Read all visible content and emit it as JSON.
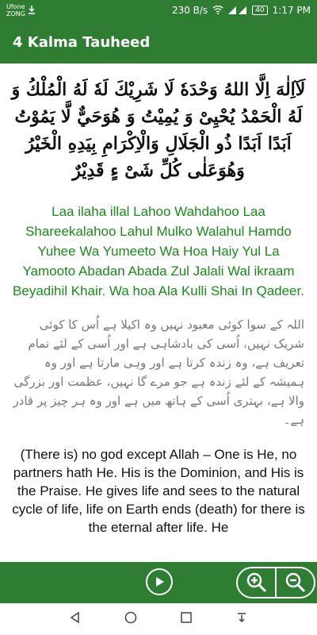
{
  "status_bar": {
    "carrier_top": "Ufone",
    "carrier_bottom": "ZONG",
    "net_speed": "230 B/s",
    "battery": "40",
    "time": "1:17 PM"
  },
  "app_bar": {
    "title": "4 Kalma Tauheed"
  },
  "content": {
    "arabic": "لَآاِلٰهَ اِلَّا اللهُ وَحْدَهٗ لَا شَرِيْكَ لَهٗ لَهُ الْمُلْكُ وَ لَهُ الْحَمْدُ يُحْيِىْ وَ يُمِيْتُ وَ هُوَحَيٌّ لَّا يَمُوْتُ اَبَدًا اَبَدًا ذُو الْجَلَالِ وَالْاِكْرَامِ بِيَدِهِ الْخَيْرُ وَهُوَعَلٰى كُلِّ شَیْ ءٍ قَدِيْرٌ",
    "transliteration": "Laa ilaha illal Lahoo Wahdahoo Laa Shareekalahoo Lahul Mulko Walahul Hamdo Yuhee Wa Yumeeto Wa Hoa Haiy Yul La Yamooto Abadan Abada Zul Jalali Wal ikraam Beyadihil Khair. Wa hoa Ala Kulli Shai In Qadeer.",
    "urdu": "اللہ کے سوا کوئی معبود نہیں وہ اکیلا ہے اُس کا کوئی شریک نہیں، اُسی کی بادشاہی ہے اور اُسی کے لئے تمام تعریف ہے، وہ زندہ کرتا ہے اور وہی مارتا ہے اور وہ ہمیشہ کے لئے زندہ ہے جو مرے گا نہیں، عظمت اور بزرگی والا ہے، بہتری اُسی کے ہاتھ میں ہے اور وہ ہر چیز پر قادر ہے۔",
    "english": "(There is) no god except Allah – One is He, no partners hath He. His is the Dominion, and His is the Praise. He gives life and sees to the natural cycle of life, life on Earth ends (death) for there is the eternal after life. He"
  },
  "bottom_bar": {
    "play_icon": "play-circle-icon",
    "zoom_in_icon": "zoom-in-icon",
    "zoom_out_icon": "zoom-out-icon"
  },
  "colors": {
    "primary": "#2e7d32",
    "transliteration": "#1b8a1b",
    "urdu": "#777777"
  }
}
